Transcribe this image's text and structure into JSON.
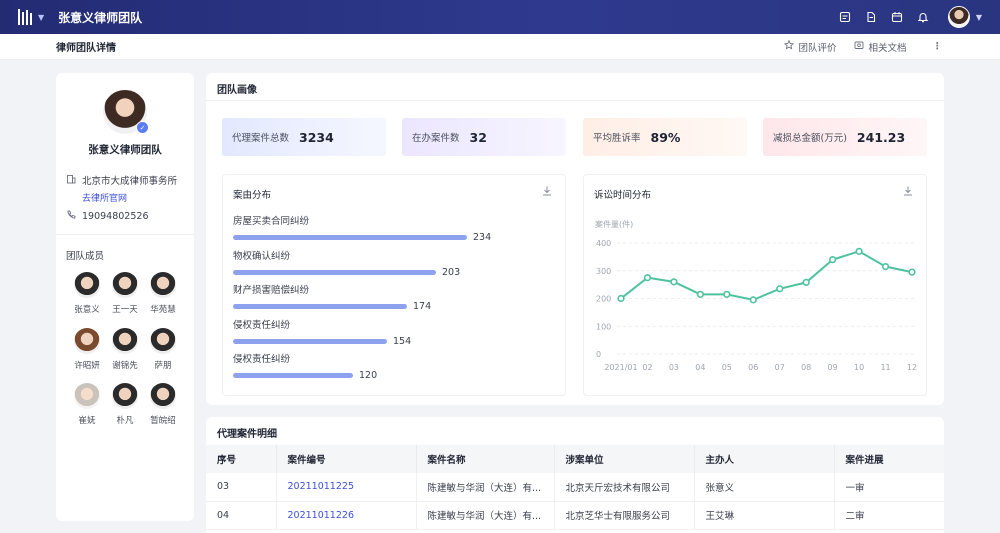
{
  "app": {
    "title": "张意义律师团队"
  },
  "subheader": {
    "title": "律师团队详情",
    "actions": {
      "rating": "团队评价",
      "docs": "相关文档"
    }
  },
  "profile": {
    "name": "张意义律师团队",
    "office": "北京市大成律师事务所",
    "office_link": "去律所官网",
    "phone": "19094802526"
  },
  "members": {
    "title": "团队成员",
    "list": [
      "张意义",
      "王一天",
      "华苑慧",
      "许昭妍",
      "谢锦先",
      "萨朋",
      "崔妩",
      "朴凡",
      "暂皖绍"
    ]
  },
  "portrait": {
    "title": "团队画像",
    "stats": [
      {
        "label": "代理案件总数",
        "value": "3234"
      },
      {
        "label": "在办案件数",
        "value": "32"
      },
      {
        "label": "平均胜诉率",
        "value": "89%"
      },
      {
        "label": "减损总金额(万元)",
        "value": "241.23"
      }
    ],
    "case_title": "案由分布",
    "time_title": "诉讼时间分布"
  },
  "chart_data": [
    {
      "type": "bar",
      "orientation": "horizontal",
      "title": "案由分布",
      "categories": [
        "房屋买卖合同纠纷",
        "物权确认纠纷",
        "财产损害赔偿纠纷",
        "侵权责任纠纷",
        "侵权责任纠纷"
      ],
      "values": [
        234,
        203,
        174,
        154,
        120
      ]
    },
    {
      "type": "line",
      "title": "诉讼时间分布",
      "ylabel": "案件量(件)",
      "x": [
        "2021/01",
        "02",
        "03",
        "04",
        "05",
        "06",
        "07",
        "08",
        "09",
        "10",
        "11",
        "12"
      ],
      "values": [
        200,
        275,
        260,
        215,
        215,
        195,
        235,
        258,
        340,
        370,
        315,
        295
      ],
      "ylim": [
        0,
        400
      ],
      "yticks": [
        0,
        100,
        200,
        300,
        400
      ],
      "color": "#4cc39b",
      "grid": true
    }
  ],
  "table": {
    "title": "代理案件明细",
    "columns": [
      "序号",
      "案件编号",
      "案件名称",
      "涉案单位",
      "主办人",
      "案件进展"
    ],
    "rows": [
      [
        "03",
        "20211011225",
        "陈建敏与华润（大连）有...",
        "北京天斤宏技术有限公司",
        "张意义",
        "一审"
      ],
      [
        "04",
        "20211011226",
        "陈建敏与华润（大连）有...",
        "北京芝华士有限服务公司",
        "王艾琳",
        "二审"
      ]
    ]
  }
}
